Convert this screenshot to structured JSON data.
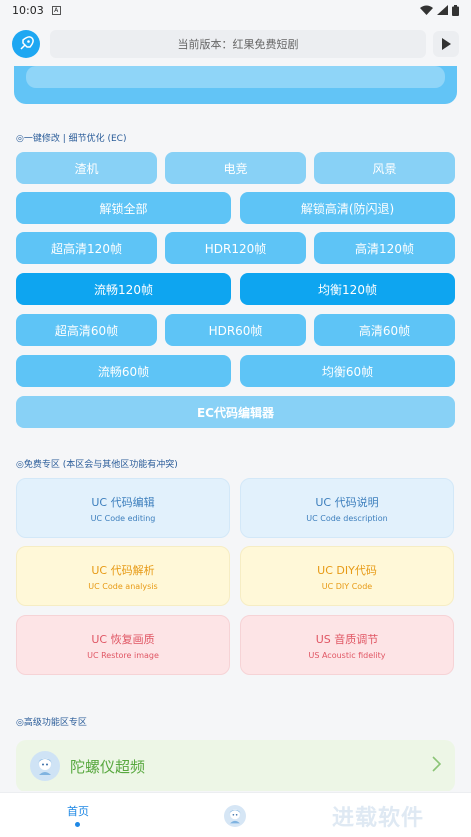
{
  "status_bar": {
    "time": "10:03",
    "a_label": "A"
  },
  "header": {
    "version_text": "当前版本：红果免费短剧",
    "play_icon": "play-icon",
    "logo_icon": "rocket-icon"
  },
  "section_ec": {
    "title": "◎一键修改 | 细节优化 (EC)",
    "buttons": {
      "row1": [
        "渣机",
        "电竞",
        "风景"
      ],
      "row2": [
        "解锁全部",
        "解锁高清(防闪退)"
      ],
      "row3": [
        "超高清120帧",
        "HDR120帧",
        "高清120帧"
      ],
      "row4": [
        "流畅120帧",
        "均衡120帧"
      ],
      "row5": [
        "超高清60帧",
        "HDR60帧",
        "高清60帧"
      ],
      "row6": [
        "流畅60帧",
        "均衡60帧"
      ],
      "editor": "EC代码编辑器"
    }
  },
  "section_free": {
    "title": "◎免费专区 (本区会与其他区功能有冲突)",
    "cards": [
      {
        "title": "UC 代码编辑",
        "subtitle": "UC Code editing"
      },
      {
        "title": "UC 代码说明",
        "subtitle": "UC Code description"
      },
      {
        "title": "UC 代码解析",
        "subtitle": "UC Code analysis"
      },
      {
        "title": "UC DIY代码",
        "subtitle": "UC DIY Code"
      },
      {
        "title": "UC 恢复画质",
        "subtitle": "UC Restore image"
      },
      {
        "title": "US 音质调节",
        "subtitle": "US Acoustic fidelity"
      }
    ]
  },
  "section_advanced": {
    "title": "◎高级功能区专区",
    "gyro_label": "陀螺仪超频"
  },
  "bottom_nav": {
    "home_label": "首页",
    "watermark": "进载软件"
  },
  "colors": {
    "accent": "#1ea7f2",
    "button_light": "#88d1f6",
    "button_mid": "#5ec4f6",
    "button_dark": "#0ea5f0",
    "nav_active": "#1e88e5"
  }
}
